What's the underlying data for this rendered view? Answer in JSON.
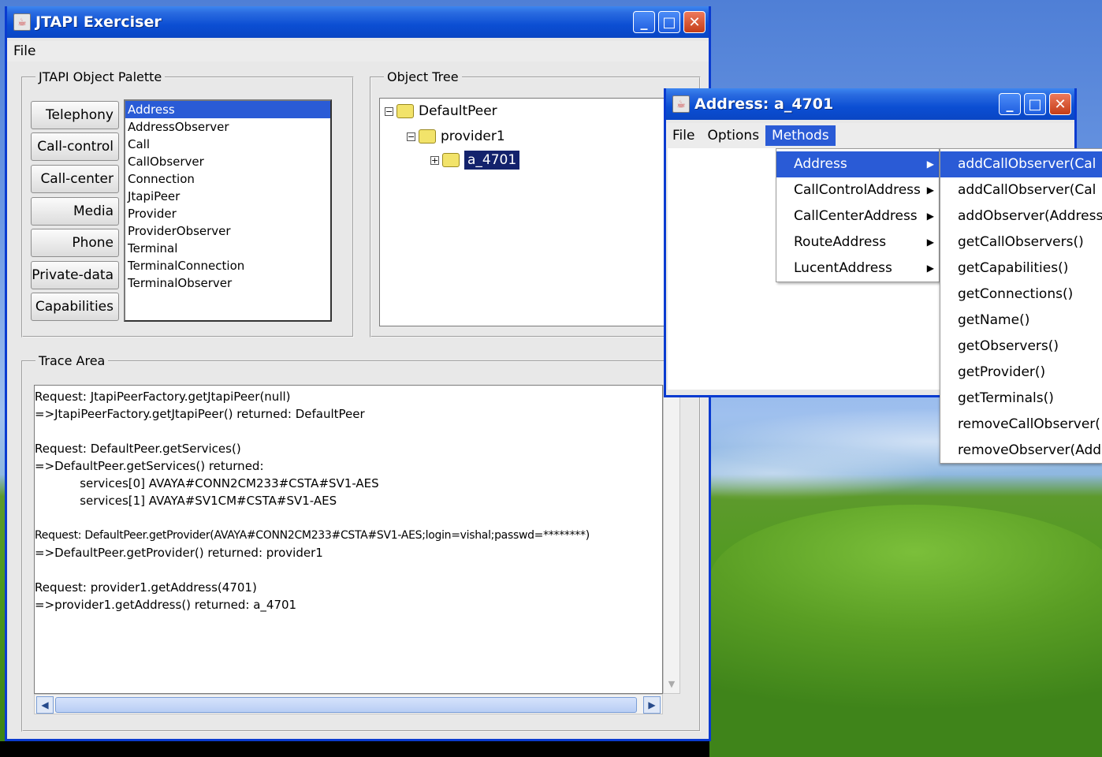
{
  "main_window": {
    "title": "JTAPI Exerciser",
    "menu": [
      "File"
    ],
    "palette_group": {
      "legend": "JTAPI Object Palette",
      "buttons": [
        "Telephony",
        "Call-control",
        "Call-center",
        "Media",
        "Phone",
        "Private-data",
        "Capabilities"
      ],
      "list_items": [
        "Address",
        "AddressObserver",
        "Call",
        "CallObserver",
        "Connection",
        "JtapiPeer",
        "Provider",
        "ProviderObserver",
        "Terminal",
        "TerminalConnection",
        "TerminalObserver"
      ],
      "selected_item": "Address"
    },
    "object_tree": {
      "legend": "Object Tree",
      "nodes": [
        "DefaultPeer",
        "provider1",
        "a_4701"
      ],
      "selected": "a_4701"
    },
    "trace_area": {
      "legend": "Trace Area",
      "lines": [
        "Request: JtapiPeerFactory.getJtapiPeer(null)",
        "=>JtapiPeerFactory.getJtapiPeer() returned: DefaultPeer",
        "",
        "Request: DefaultPeer.getServices()",
        "=>DefaultPeer.getServices() returned:",
        "            services[0] AVAYA#CONN2CM233#CSTA#SV1-AES",
        "            services[1] AVAYA#SV1CM#CSTA#SV1-AES",
        "",
        "Request: DefaultPeer.getProvider(AVAYA#CONN2CM233#CSTA#SV1-AES;login=vishal;passwd=********)",
        "=>DefaultPeer.getProvider() returned: provider1",
        "",
        "Request: provider1.getAddress(4701)",
        "=>provider1.getAddress() returned: a_4701"
      ]
    }
  },
  "address_window": {
    "title": "Address: a_4701",
    "menu": [
      "File",
      "Options",
      "Methods"
    ],
    "active_menu": "Methods",
    "methods_menu": [
      "Address",
      "CallControlAddress",
      "CallCenterAddress",
      "RouteAddress",
      "LucentAddress"
    ],
    "selected_method_group": "Address",
    "address_submenu": [
      "addCallObserver(Cal",
      "addCallObserver(Cal",
      "addObserver(Address",
      "getCallObservers()",
      "getCapabilities()",
      "getConnections()",
      "getName()",
      "getObservers()",
      "getProvider()",
      "getTerminals()",
      "removeCallObserver(",
      "removeObserver(Addr"
    ]
  },
  "colors": {
    "titlebar": "#0b4ed3",
    "selection": "#2a5bd6",
    "tree_selection": "#13226c"
  }
}
